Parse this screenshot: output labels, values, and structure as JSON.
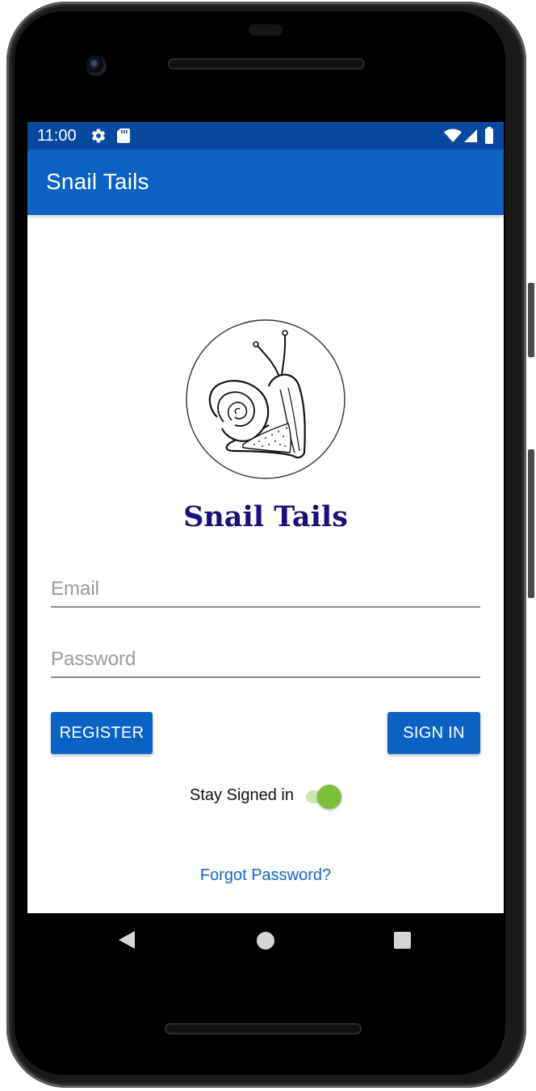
{
  "status_bar": {
    "time": "11:00",
    "icons": [
      "gear-icon",
      "sd-card-icon",
      "wifi-icon",
      "cell-signal-icon",
      "battery-icon"
    ]
  },
  "app_bar": {
    "title": "Snail Tails"
  },
  "brand": {
    "title": "Snail Tails",
    "logo": "snail-logo"
  },
  "form": {
    "email_placeholder": "Email",
    "email_value": "",
    "password_placeholder": "Password",
    "password_value": ""
  },
  "buttons": {
    "register": "REGISTER",
    "sign_in": "SIGN IN"
  },
  "stay_signed_in": {
    "label": "Stay Signed in",
    "enabled": true
  },
  "links": {
    "forgot_password": "Forgot Password?"
  },
  "colors": {
    "status_bar": "#08489e",
    "app_bar": "#0b62c4",
    "brand_title": "#1b0f7a",
    "switch_on": "#7bbf3a",
    "link": "#1565c0"
  },
  "nav_bar": {
    "icons": [
      "back-icon",
      "home-icon",
      "recents-icon"
    ]
  }
}
